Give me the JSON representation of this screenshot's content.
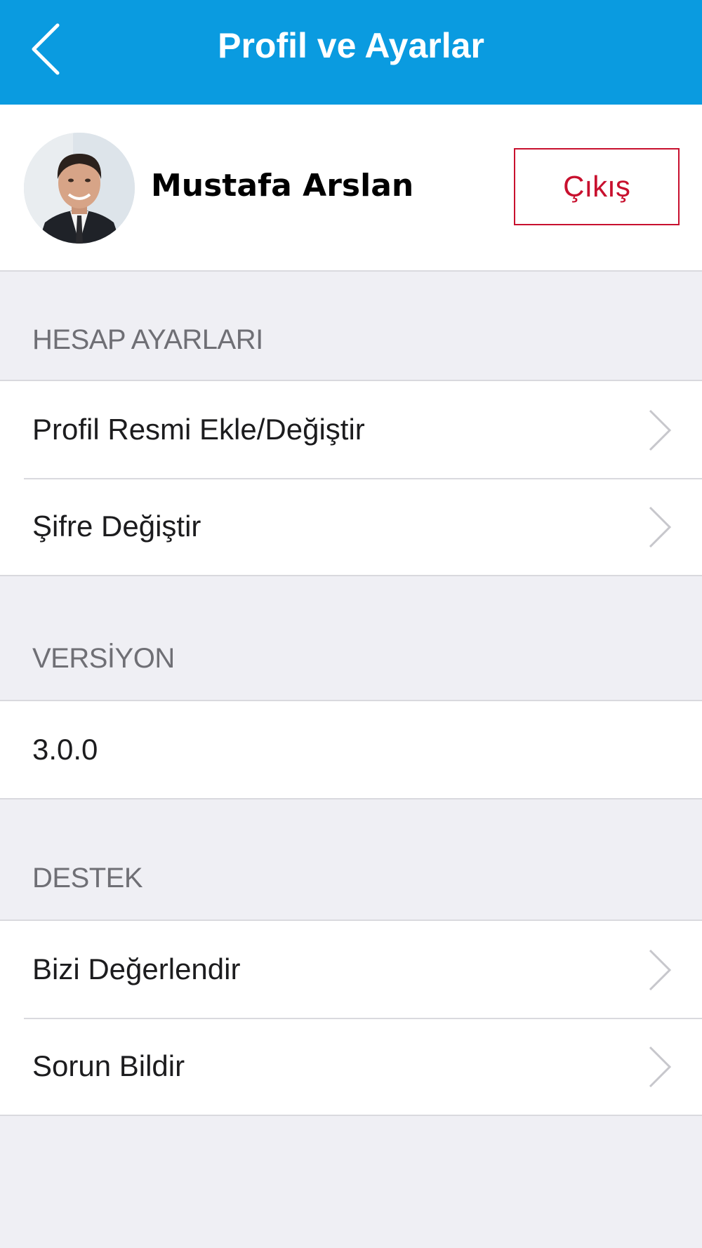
{
  "header": {
    "title": "Profil ve Ayarlar",
    "back_icon": "chevron-left-icon",
    "color": "#0a9be0"
  },
  "profile": {
    "name": "Mustafa Arslan",
    "logout_label": "Çıkış",
    "logout_color": "#c8102e"
  },
  "sections": {
    "account": {
      "title": "HESAP AYARLARI",
      "items": [
        {
          "label": "Profil Resmi Ekle/Değiştir"
        },
        {
          "label": "Şifre Değiştir"
        }
      ]
    },
    "version": {
      "title": "VERSİYON",
      "value": "3.0.0"
    },
    "support": {
      "title": "DESTEK",
      "items": [
        {
          "label": "Bizi Değerlendir"
        },
        {
          "label": "Sorun Bildir"
        }
      ]
    }
  }
}
